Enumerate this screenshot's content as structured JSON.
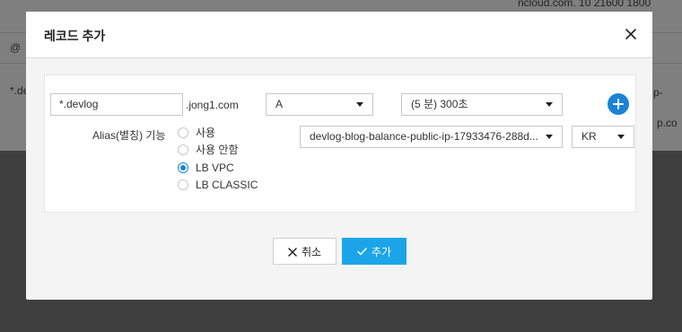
{
  "background": {
    "top_right_text": "ncloud.com. 10 21600 1800",
    "row_labels": [
      "@",
      "*.de"
    ],
    "right_fragments": [
      "p-",
      "p.co"
    ]
  },
  "modal": {
    "title": "레코드 추가",
    "close_icon": "close-icon",
    "record": {
      "name_value": ".devlog",
      "name_prefix": "*",
      "domain_suffix": ".jong1.com",
      "type_value": "A",
      "ttl_value": "(5 분) 300초",
      "add_icon": "plus-circle-icon"
    },
    "alias": {
      "label": "Alias(별칭) 기능",
      "options": [
        {
          "label": "사용",
          "checked": false
        },
        {
          "label": "사용 안함",
          "checked": false
        },
        {
          "label": "LB VPC",
          "checked": true
        },
        {
          "label": "LB CLASSIC",
          "checked": false
        }
      ],
      "target_value": "devlog-blog-balance-public-ip-17933476-288d...",
      "region_value": "KR"
    },
    "buttons": {
      "cancel_label": "취소",
      "add_label": "추가"
    },
    "colors": {
      "accent": "#1b82d6",
      "primary_button": "#1ba5e8"
    }
  }
}
